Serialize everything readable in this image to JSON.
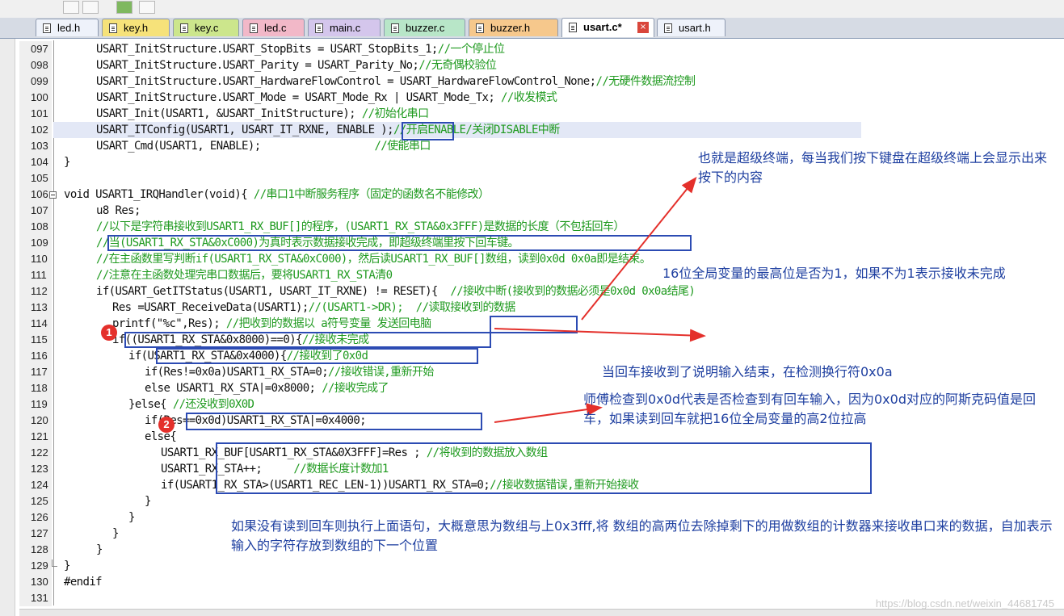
{
  "tabs": [
    {
      "label": "led.h",
      "color": "#eef2fa",
      "active": false
    },
    {
      "label": "key.h",
      "color": "#f6e27a",
      "active": false
    },
    {
      "label": "key.c",
      "color": "#cce68c",
      "active": false
    },
    {
      "label": "led.c",
      "color": "#f2b8c8",
      "active": false
    },
    {
      "label": "main.c",
      "color": "#d4c6ec",
      "active": false
    },
    {
      "label": "buzzer.c",
      "color": "#b8e6c8",
      "active": false
    },
    {
      "label": "buzzer.h",
      "color": "#f6c88c",
      "active": false
    },
    {
      "label": "usart.c*",
      "color": "#ffffff",
      "active": true
    },
    {
      "label": "usart.h",
      "color": "#eef2fa",
      "active": false
    }
  ],
  "close_icon": "×",
  "code_lines": [
    {
      "num": "097",
      "indent": 8,
      "code": "USART_InitStructure.USART_StopBits = USART_StopBits_1;",
      "comment": "//一个停止位"
    },
    {
      "num": "098",
      "indent": 8,
      "code": "USART_InitStructure.USART_Parity = USART_Parity_No;",
      "comment": "//无奇偶校验位"
    },
    {
      "num": "099",
      "indent": 8,
      "code": "USART_InitStructure.USART_HardwareFlowControl = USART_HardwareFlowControl_None;",
      "comment": "//无硬件数据流控制"
    },
    {
      "num": "100",
      "indent": 8,
      "code": "USART_InitStructure.USART_Mode = USART_Mode_Rx | USART_Mode_Tx;",
      "comment": " //收发模式"
    },
    {
      "num": "101",
      "indent": 8,
      "code": "USART_Init(USART1, &USART_InitStructure);",
      "comment": " //初始化串口"
    },
    {
      "num": "102",
      "indent": 8,
      "code": "USART_ITConfig(USART1, USART_IT_RXNE, ENABLE );",
      "comment": "//开启ENABLE/关闭DISABLE中断",
      "hl": true
    },
    {
      "num": "103",
      "indent": 8,
      "code": "USART_Cmd(USART1, ENABLE);                  ",
      "comment": "//使能串口"
    },
    {
      "num": "104",
      "indent": 0,
      "code": "}",
      "comment": ""
    },
    {
      "num": "105",
      "indent": 0,
      "code": "",
      "comment": ""
    },
    {
      "num": "106",
      "indent": 0,
      "code": "void USART1_IRQHandler(void){",
      "comment": " //串口1中断服务程序（固定的函数名不能修改）"
    },
    {
      "num": "107",
      "indent": 8,
      "code": "u8 Res;",
      "comment": ""
    },
    {
      "num": "108",
      "indent": 8,
      "code": "",
      "comment": "//以下是字符串接收到USART1_RX_BUF[]的程序，(USART1_RX_STA&0x3FFF)是数据的长度（不包括回车）"
    },
    {
      "num": "109",
      "indent": 8,
      "code": "",
      "comment": "//当(USART1_RX_STA&0xC000)为真时表示数据接收完成，即超级终端里按下回车键。"
    },
    {
      "num": "110",
      "indent": 8,
      "code": "",
      "comment": "//在主函数里写判断if(USART1_RX_STA&0xC000)，然后读USART1_RX_BUF[]数组，读到0x0d 0x0a即是结束。"
    },
    {
      "num": "111",
      "indent": 8,
      "code": "",
      "comment": "//注意在主函数处理完串口数据后，要将USART1_RX_STA清0"
    },
    {
      "num": "112",
      "indent": 8,
      "code": "if(USART_GetITStatus(USART1, USART_IT_RXNE) != RESET){",
      "comment": "  //接收中断(接收到的数据必须是0x0d 0x0a结尾)"
    },
    {
      "num": "113",
      "indent": 12,
      "code": "Res =USART_ReceiveData(USART1);",
      "comment": "//(USART1->DR);  //读取接收到的数据"
    },
    {
      "num": "114",
      "indent": 12,
      "code": "printf(\"%c\",Res);",
      "comment": " //把收到的数据以 a符号变量 发送回电脑"
    },
    {
      "num": "115",
      "indent": 12,
      "code": "if((USART1_RX_STA&0x8000)==0){",
      "comment": "//接收未完成"
    },
    {
      "num": "116",
      "indent": 16,
      "code": "if(USART1_RX_STA&0x4000){",
      "comment": "//接收到了0x0d"
    },
    {
      "num": "117",
      "indent": 20,
      "code": "if(Res!=0x0a)USART1_RX_STA=0;",
      "comment": "//接收错误,重新开始"
    },
    {
      "num": "118",
      "indent": 20,
      "code": "else USART1_RX_STA|=0x8000;",
      "comment": " //接收完成了"
    },
    {
      "num": "119",
      "indent": 16,
      "code": "}else{",
      "comment": " //还没收到0X0D"
    },
    {
      "num": "120",
      "indent": 20,
      "code": "if(Res==0x0d)USART1_RX_STA|=0x4000;",
      "comment": ""
    },
    {
      "num": "121",
      "indent": 20,
      "code": "else{",
      "comment": ""
    },
    {
      "num": "122",
      "indent": 24,
      "code": "USART1_RX_BUF[USART1_RX_STA&0X3FFF]=Res ;",
      "comment": " //将收到的数据放入数组"
    },
    {
      "num": "123",
      "indent": 24,
      "code": "USART1_RX_STA++;     ",
      "comment": "//数据长度计数加1"
    },
    {
      "num": "124",
      "indent": 24,
      "code": "if(USART1_RX_STA>(USART1_REC_LEN-1))USART1_RX_STA=0;",
      "comment": "//接收数据错误,重新开始接收"
    },
    {
      "num": "125",
      "indent": 20,
      "code": "}",
      "comment": ""
    },
    {
      "num": "126",
      "indent": 16,
      "code": "}",
      "comment": ""
    },
    {
      "num": "127",
      "indent": 12,
      "code": "}",
      "comment": ""
    },
    {
      "num": "128",
      "indent": 8,
      "code": "}",
      "comment": ""
    },
    {
      "num": "129",
      "indent": 0,
      "code": "}",
      "comment": ""
    },
    {
      "num": "130",
      "indent": 0,
      "code": "#endif",
      "comment": ""
    },
    {
      "num": "131",
      "indent": 0,
      "code": "",
      "comment": ""
    }
  ],
  "annotations": {
    "terminal_note": "也就是超级终端，每当我们按下键盘在超级终端上会显示出来按下的内容",
    "bit16_note": "16位全局变量的最高位是否为1，如果不为1表示接收未完成",
    "enter_note": "当回车接收到了说明输入结束，在检测换行符0x0a",
    "ascii_note": "师傅检查到0x0d代表是否检查到有回车输入，因为0x0d对应的阿斯克码值是回车，如果读到回车就把16位全局变量的高2位拉高",
    "bottom_note": "如果没有读到回车则执行上面语句，大概意思为数组与上0x3fff,将 数组的高两位去除掉剩下的用做数组的计数器来接收串口来的数据，自加表示输入的字符存放到数组的下一个位置",
    "badge1": "1",
    "badge2": "2"
  },
  "watermark": "https://blog.csdn.net/weixin_44681745",
  "colors": {
    "annotation_text": "#1e3fa0",
    "box": "#2c4bb3",
    "arrow": "#e4302b",
    "comment": "#1f9a1f",
    "highlight_line": "#e3e8f6"
  }
}
